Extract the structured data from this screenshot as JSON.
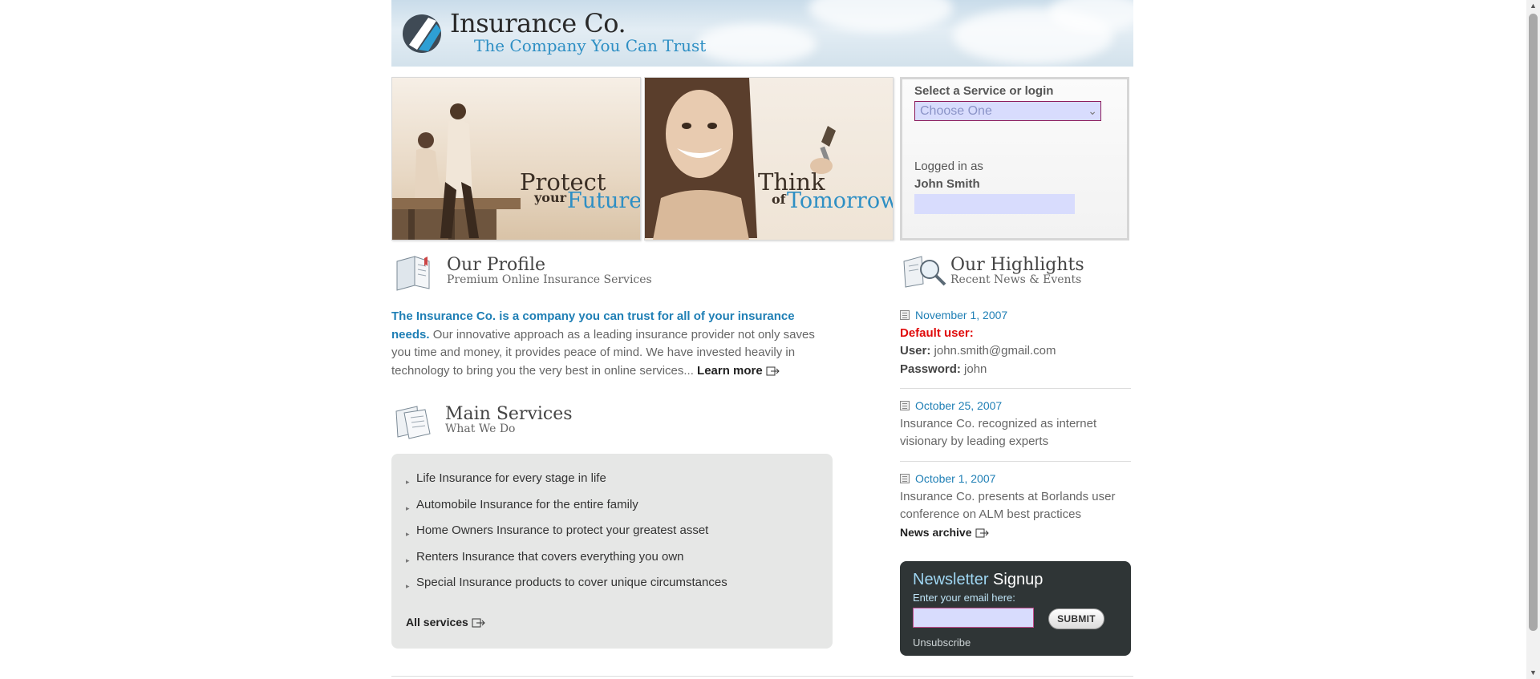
{
  "header": {
    "logo_name": "Insurance Co.",
    "logo_tagline": "The Company You Can Trust"
  },
  "banners": [
    {
      "word1": "Protect",
      "word2": "your",
      "word3": "Future"
    },
    {
      "word1": "Think",
      "word2": "of",
      "word3": "Tomorrow"
    }
  ],
  "login": {
    "title": "Select a Service or login",
    "select_value": "Choose One",
    "logged_in_label": "Logged in as",
    "user_name": "John Smith"
  },
  "profile": {
    "title": "Our Profile",
    "subtitle": "Premium Online Insurance Services",
    "lead": "The Insurance Co. is a company you can trust for all of your insurance needs.",
    "body": " Our innovative approach as a leading insurance provider not only saves you time and money, it provides peace of mind. We have invested heavily in technology to bring you the very best in online services... ",
    "learn_more": "Learn more"
  },
  "services": {
    "title": "Main Services",
    "subtitle": "What We Do",
    "items": [
      "Life Insurance for every stage in life",
      "Automobile Insurance for the entire family",
      "Home Owners Insurance to protect your greatest asset",
      "Renters Insurance that covers everything you own",
      "Special Insurance products to cover unique circumstances"
    ],
    "all_services": "All services"
  },
  "highlights": {
    "title": "Our Highlights",
    "subtitle": "Recent News & Events",
    "items": [
      {
        "date": "November 1, 2007",
        "default_user_label": "Default user:",
        "user_label": "User:",
        "user_value": " john.smith@gmail.com",
        "password_label": "Password:",
        "password_value": " john"
      },
      {
        "date": "October 25, 2007",
        "text": "Insurance Co. recognized as internet visionary by leading experts"
      },
      {
        "date": "October 1, 2007",
        "text": "Insurance Co. presents at Borlands user conference on ALM best practices"
      }
    ],
    "news_archive": "News archive"
  },
  "newsletter": {
    "title_part1": "Newsletter",
    "title_part2": " Signup",
    "label": "Enter your email here:",
    "submit": "SUBMIT",
    "unsubscribe": "Unsubscribe"
  },
  "colors": {
    "accent_blue": "#1f7fb5",
    "alert_red": "#e00b0b",
    "newsletter_bg": "#2f3536"
  }
}
